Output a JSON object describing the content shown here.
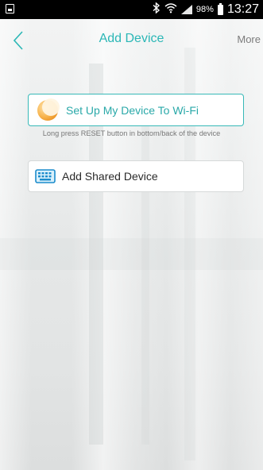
{
  "status_bar": {
    "battery_percent": "98%",
    "time": "13:27"
  },
  "nav": {
    "title": "Add Device",
    "more_label": "More"
  },
  "options": {
    "wifi_label": "Set Up My Device To Wi-Fi",
    "wifi_hint": "Long press RESET button in bottom/back of the device",
    "shared_label": "Add Shared Device"
  },
  "colors": {
    "accent": "#2bb7b6",
    "status_bar": "#000000",
    "wifi_icon": "#f5a623"
  },
  "icons": {
    "wifi_option": "orange-crescent-icon",
    "shared_option": "keyboard-icon",
    "back": "chevron-left-icon"
  }
}
